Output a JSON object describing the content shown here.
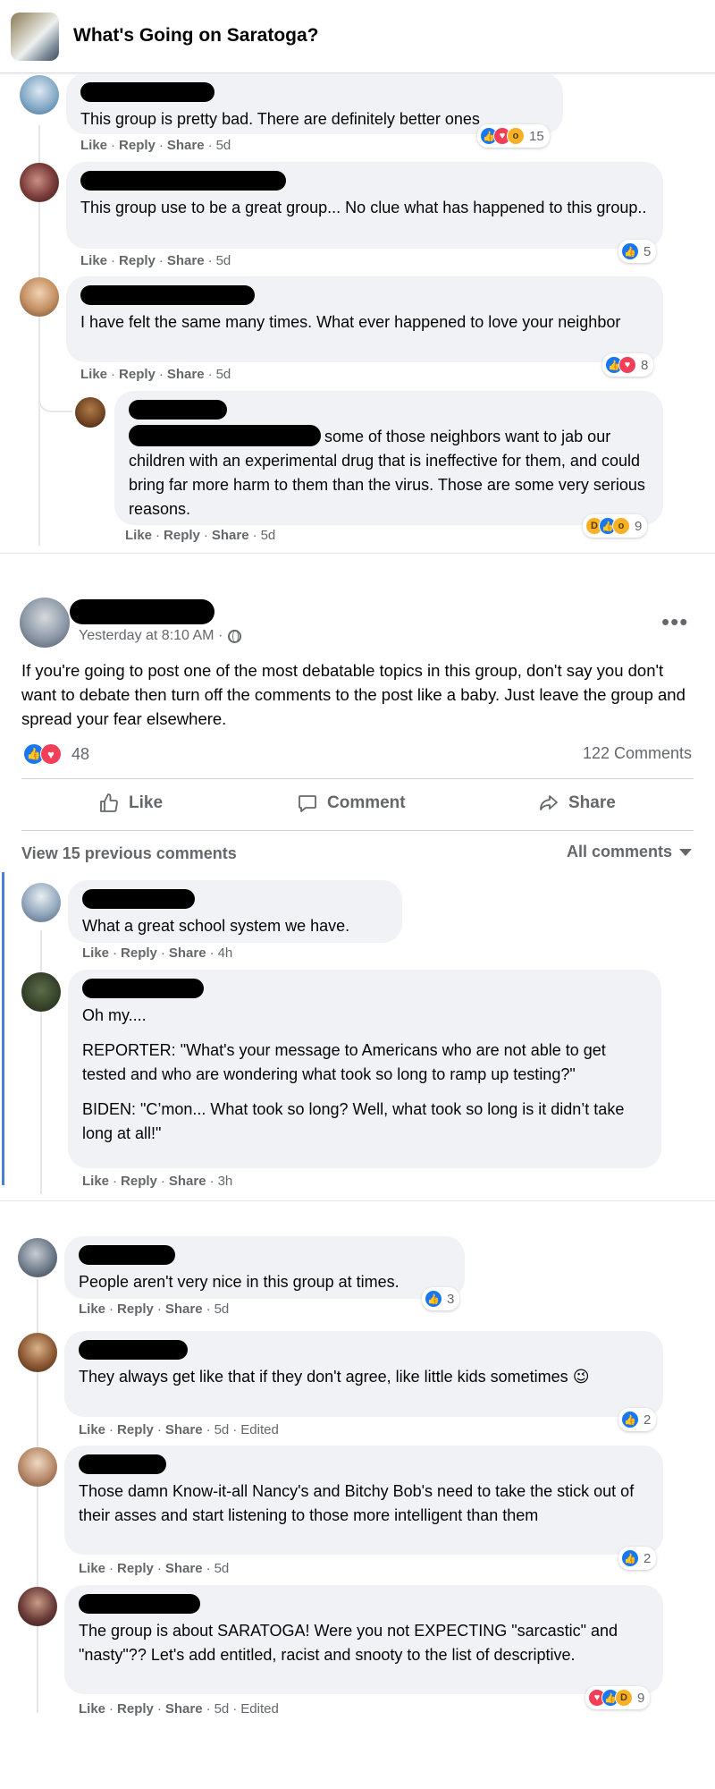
{
  "header": {
    "title": "What's Going on Saratoga?"
  },
  "actions": {
    "like": "Like",
    "reply": "Reply",
    "share": "Share",
    "sep": "·"
  },
  "thread1": [
    {
      "text": "This group is pretty bad. There are definitely better ones",
      "time": "5d",
      "reaction_count": "15",
      "reactions": [
        "like-icon",
        "love-icon",
        "wow-icon"
      ]
    },
    {
      "text": "This group use to be a great group... No clue what has happened to this group..",
      "time": "5d",
      "reaction_count": "5",
      "reactions": [
        "like-icon"
      ]
    },
    {
      "text": "I have felt the same many times. What ever happened to love your neighbor",
      "time": "5d",
      "reaction_count": "8",
      "reactions": [
        "like-icon",
        "love-icon"
      ]
    },
    {
      "text": "some of those neighbors want to jab our children with an experimental drug that is ineffective for them, and could bring far more harm to them than the virus. Those are some very serious reasons.",
      "time": "5d",
      "reaction_count": "9",
      "reactions": [
        "haha-icon",
        "like-icon",
        "wow-icon"
      ]
    }
  ],
  "post": {
    "meta": "Yesterday at 8:10 AM ·",
    "text": "If you're going to post one of the most debatable topics in this group, don't say you don't want to debate then turn off the comments to the post like a baby.  Just leave the group and spread your fear elsewhere.",
    "reaction_count": "48",
    "comments_count": "122 Comments",
    "buttons": {
      "like": "Like",
      "comment": "Comment",
      "share": "Share"
    },
    "view_previous": "View 15 previous comments",
    "filter": "All comments",
    "comments": [
      {
        "text": "What a great school system we have.",
        "time": "4h"
      },
      {
        "paragraphs": [
          "Oh my....",
          "REPORTER: \"What's your message to Americans who are not able to get tested and who are wondering what took so long to ramp up testing?\"",
          "BIDEN: \"C’mon... What took so long? Well, what took so long is it didn’t take long at all!\""
        ],
        "time": "3h"
      }
    ]
  },
  "thread2": [
    {
      "text": "People aren't very nice in this group at times.",
      "time": "5d",
      "reaction_count": "3",
      "reactions": [
        "like-icon"
      ]
    },
    {
      "text": "They always get like that if they don't agree, like little kids sometimes",
      "emoji": "😉",
      "time": "5d",
      "edited": "Edited",
      "reaction_count": "2",
      "reactions": [
        "like-icon"
      ]
    },
    {
      "text": "Those damn Know-it-all Nancy's and Bitchy Bob's need to take the stick out of their asses and start listening to those more intelligent than them",
      "time": "5d",
      "reaction_count": "2",
      "reactions": [
        "like-icon"
      ]
    },
    {
      "text": "The group is about SARATOGA! Were you not EXPECTING \"sarcastic\" and \"nasty\"?? Let's add entitled, racist and snooty to the list of descriptive.",
      "time": "5d",
      "edited": "Edited",
      "reaction_count": "9",
      "reactions": [
        "love-icon",
        "like-icon",
        "haha-icon"
      ]
    }
  ],
  "colors": {
    "accent": "#1877f2",
    "love": "#f33e58",
    "bubble": "#f0f2f5",
    "meta": "#65676b"
  }
}
